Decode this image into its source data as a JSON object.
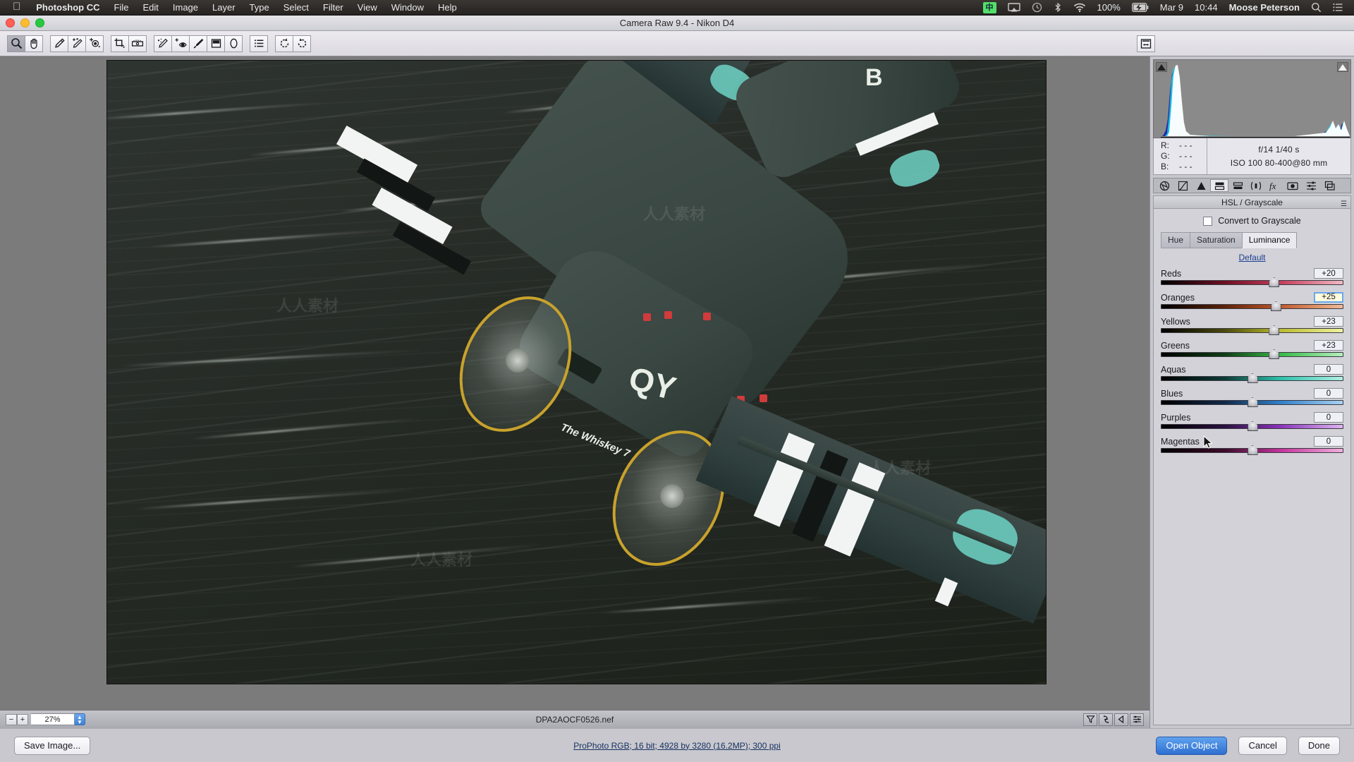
{
  "menubar": {
    "apple_icon": "apple-logo-icon",
    "app_name": "Photoshop CC",
    "items": [
      "File",
      "Edit",
      "Image",
      "Layer",
      "Type",
      "Select",
      "Filter",
      "View",
      "Window",
      "Help"
    ],
    "status": {
      "input_source_badge": "中",
      "airplay_icon": "airplay-icon",
      "timemachine_icon": "time-machine-icon",
      "bluetooth_icon": "bluetooth-icon",
      "wifi_icon": "wifi-icon",
      "battery_percent": "100%",
      "battery_icon": "battery-charging-icon",
      "date": "Mar 9",
      "time": "10:44",
      "user": "Moose Peterson",
      "search_icon": "search-icon",
      "notification_icon": "notification-center-icon"
    }
  },
  "window": {
    "title": "Camera Raw 9.4  -  Nikon D4"
  },
  "toolbar": {
    "groups": [
      [
        {
          "name": "zoom-tool",
          "glyph": "zoom-icon",
          "active": true
        },
        {
          "name": "hand-tool",
          "glyph": "hand-icon",
          "active": false
        }
      ],
      [
        {
          "name": "white-balance-tool",
          "glyph": "eyedropper-icon",
          "active": false
        },
        {
          "name": "color-sampler-tool",
          "glyph": "color-sampler-icon",
          "active": false
        },
        {
          "name": "targeted-adjustment-tool",
          "glyph": "targeted-adjust-icon",
          "active": false
        }
      ],
      [
        {
          "name": "crop-tool",
          "glyph": "crop-icon",
          "active": false
        },
        {
          "name": "straighten-tool",
          "glyph": "straighten-icon",
          "active": false
        }
      ],
      [
        {
          "name": "spot-removal-tool",
          "glyph": "spot-removal-icon",
          "active": false
        },
        {
          "name": "red-eye-removal-tool",
          "glyph": "red-eye-icon",
          "active": false
        },
        {
          "name": "adjustment-brush-tool",
          "glyph": "brush-icon",
          "active": false
        },
        {
          "name": "graduated-filter-tool",
          "glyph": "graduated-filter-icon",
          "active": false
        },
        {
          "name": "radial-filter-tool",
          "glyph": "radial-filter-icon",
          "active": false
        }
      ],
      [
        {
          "name": "preferences-tool",
          "glyph": "preferences-icon",
          "active": false
        }
      ],
      [
        {
          "name": "rotate-counterclockwise-tool",
          "glyph": "rotate-ccw-icon",
          "active": false
        },
        {
          "name": "rotate-clockwise-tool",
          "glyph": "rotate-cw-icon",
          "active": false
        }
      ]
    ],
    "fullscreen_toggle": "toggle-fullscreen-icon"
  },
  "preview": {
    "zoom_level": "27%",
    "zoom_out_label": "−",
    "zoom_in_label": "+",
    "filename": "DPA2AOCF0526.nef",
    "footer_icons": [
      {
        "name": "filter-filmstrip-icon"
      },
      {
        "name": "sync-filmstrip-icon"
      },
      {
        "name": "collapse-filmstrip-icon"
      },
      {
        "name": "filmstrip-settings-icon"
      }
    ]
  },
  "histogram": {
    "shadow_clip_icon": "shadow-clipping-warning-icon",
    "highlight_clip_icon": "highlight-clipping-warning-icon",
    "readouts": [
      {
        "channel": "R:",
        "value": "- - -"
      },
      {
        "channel": "G:",
        "value": "- - -"
      },
      {
        "channel": "B:",
        "value": "- - -"
      }
    ],
    "exif_line1": "f/14     1/40 s",
    "exif_line2": "ISO 100     80-400@80 mm"
  },
  "panel_tabs": [
    {
      "name": "basic-panel-tab",
      "glyph": "aperture-icon",
      "selected": false
    },
    {
      "name": "tone-curve-panel-tab",
      "glyph": "curve-icon",
      "selected": false
    },
    {
      "name": "detail-panel-tab",
      "glyph": "triangle-icon",
      "selected": false
    },
    {
      "name": "hsl-grayscale-panel-tab",
      "glyph": "hsl-icon",
      "selected": true
    },
    {
      "name": "split-toning-panel-tab",
      "glyph": "split-toning-icon",
      "selected": false
    },
    {
      "name": "lens-corrections-panel-tab",
      "glyph": "lens-icon",
      "selected": false
    },
    {
      "name": "effects-panel-tab",
      "glyph": "fx-icon",
      "selected": false
    },
    {
      "name": "camera-calibration-panel-tab",
      "glyph": "camera-icon",
      "selected": false
    },
    {
      "name": "presets-panel-tab",
      "glyph": "presets-icon",
      "selected": false
    },
    {
      "name": "snapshots-panel-tab",
      "glyph": "snapshots-icon",
      "selected": false
    }
  ],
  "panel": {
    "title": "HSL / Grayscale",
    "menu_icon": "panel-menu-icon",
    "convert_to_grayscale_label": "Convert to Grayscale",
    "convert_to_grayscale_checked": false,
    "tabs": [
      {
        "label": "Hue",
        "selected": false
      },
      {
        "label": "Saturation",
        "selected": false
      },
      {
        "label": "Luminance",
        "selected": true
      }
    ],
    "default_link": "Default",
    "sliders": [
      {
        "label": "Reds",
        "value": "+20",
        "pos": 62,
        "focused": false,
        "gradient": "linear-gradient(90deg,#000000 0%,#6d1024 35%,#c23a57 65%,#f3b9c6 100%)"
      },
      {
        "label": "Oranges",
        "value": "+25",
        "pos": 63,
        "focused": true,
        "gradient": "linear-gradient(90deg,#000000 0%,#5d2208 35%,#c0562a 65%,#f2bb96 100%)"
      },
      {
        "label": "Yellows",
        "value": "+23",
        "pos": 62,
        "focused": false,
        "gradient": "linear-gradient(90deg,#000000 0%,#4a4a0b 35%,#b9bb2c 65%,#f0f2a0 100%)"
      },
      {
        "label": "Greens",
        "value": "+23",
        "pos": 62,
        "focused": false,
        "gradient": "linear-gradient(90deg,#000000 0%,#0f3d15 35%,#34b845 65%,#b6f0bd 100%)"
      },
      {
        "label": "Aquas",
        "value": "0",
        "pos": 50,
        "focused": false,
        "gradient": "linear-gradient(90deg,#000000 0%,#0c3b37 35%,#2bbfa8 65%,#aef0e4 100%)"
      },
      {
        "label": "Blues",
        "value": "0",
        "pos": 50,
        "focused": false,
        "gradient": "linear-gradient(90deg,#000000 0%,#122a49 35%,#2f7fc8 65%,#a9d3f2 100%)"
      },
      {
        "label": "Purples",
        "value": "0",
        "pos": 50,
        "focused": false,
        "gradient": "linear-gradient(90deg,#000000 0%,#2a1140 35%,#8a31b8 65%,#ddb4f0 100%)"
      },
      {
        "label": "Magentas",
        "value": "0",
        "pos": 50,
        "focused": false,
        "gradient": "linear-gradient(90deg,#000000 0%,#3d0b2a 35%,#c2329a 65%,#f0b0dc 100%)"
      }
    ]
  },
  "bottom": {
    "save_image_label": "Save Image...",
    "workflow_options": "ProPhoto RGB; 16 bit; 4928 by 3280 (16.2MP); 300 ppi",
    "open_object_label": "Open Object",
    "cancel_label": "Cancel",
    "done_label": "Done"
  },
  "colors": {
    "accent_blue": "#2f6fd0",
    "link_blue": "#1d3f8f",
    "focus_field": "#fffbdd",
    "panel_bg": "#d2d2d8"
  }
}
